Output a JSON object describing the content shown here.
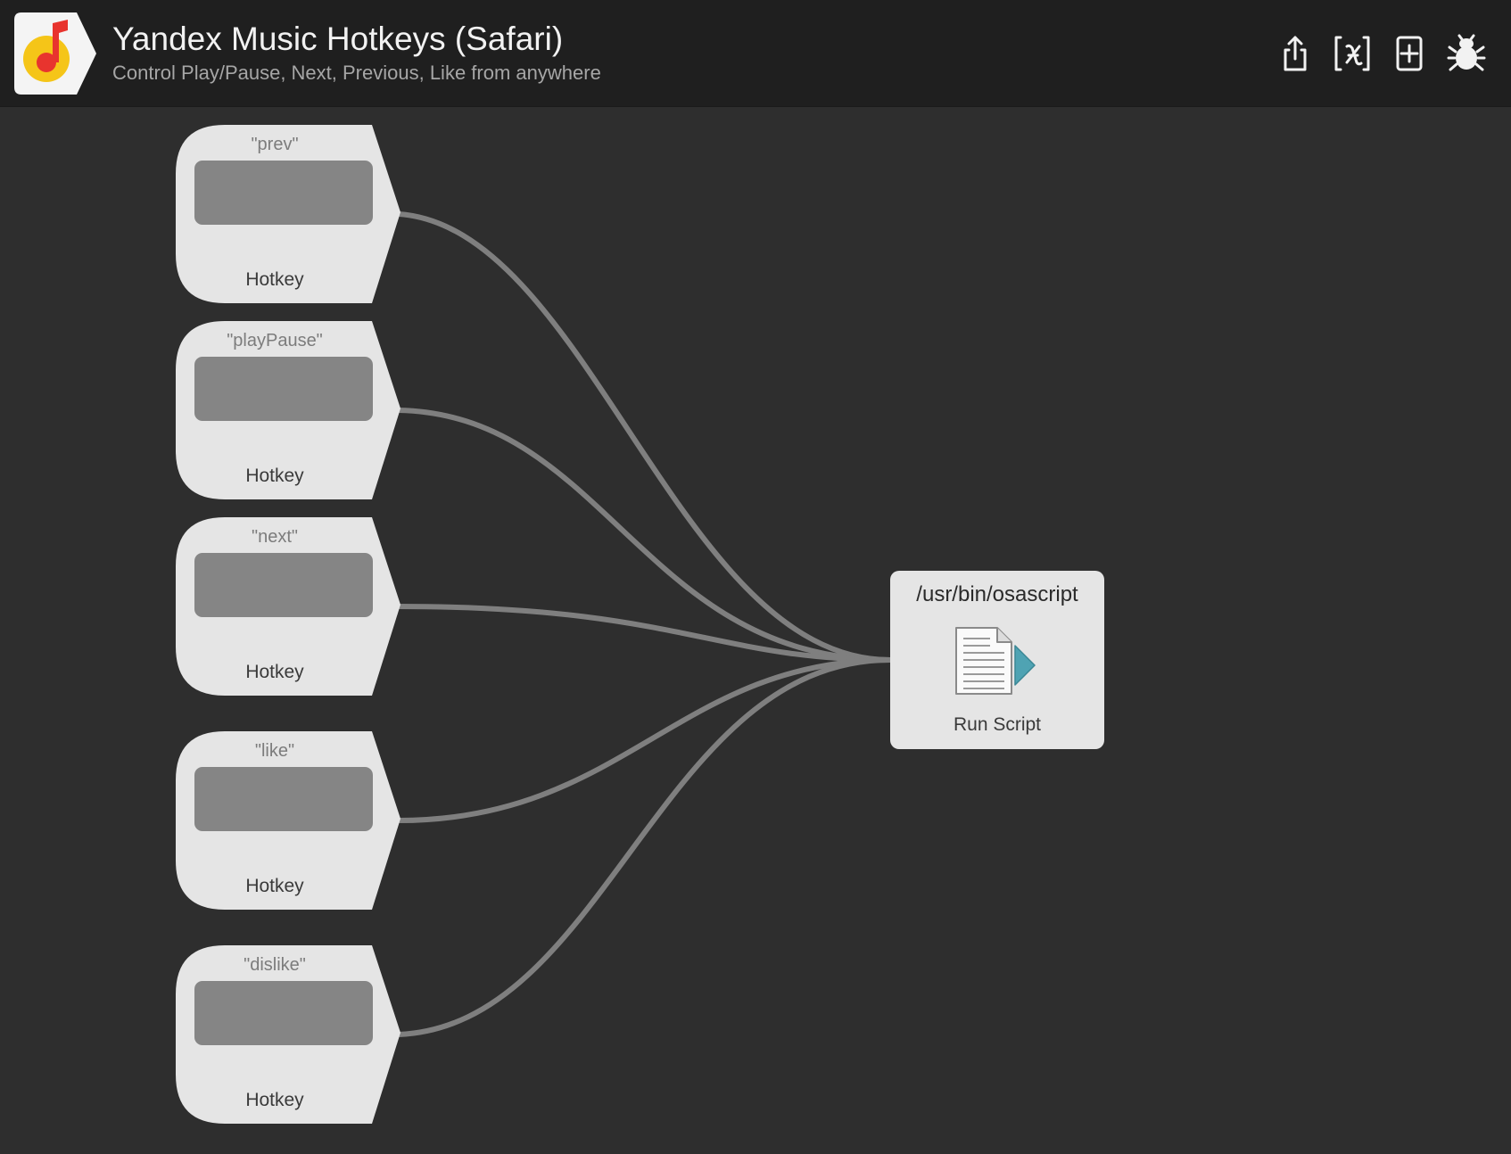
{
  "header": {
    "title": "Yandex Music Hotkeys (Safari)",
    "subtitle": "Control Play/Pause, Next, Previous, Like from anywhere",
    "app_icon": "yandex-music-note-icon",
    "toolbar": [
      {
        "icon": "share-icon"
      },
      {
        "icon": "variables-icon"
      },
      {
        "icon": "add-object-icon"
      },
      {
        "icon": "debug-bug-icon"
      }
    ]
  },
  "hotkeys": [
    {
      "variable": "\"prev\"",
      "label": "Hotkey"
    },
    {
      "variable": "\"playPause\"",
      "label": "Hotkey"
    },
    {
      "variable": "\"next\"",
      "label": "Hotkey"
    },
    {
      "variable": "\"like\"",
      "label": "Hotkey"
    },
    {
      "variable": "\"dislike\"",
      "label": "Hotkey"
    }
  ],
  "run_script": {
    "path": "/usr/bin/osascript",
    "label": "Run Script",
    "icon": "run-script-icon"
  },
  "colors": {
    "canvas_bg": "#2e2e2e",
    "header_bg": "#1f1f1f",
    "node_bg": "#e5e5e5",
    "connector": "#7f7f7f",
    "script_arrow": "#4fa3b3",
    "icon_red": "#e8342e",
    "icon_yellow": "#f5c518"
  }
}
